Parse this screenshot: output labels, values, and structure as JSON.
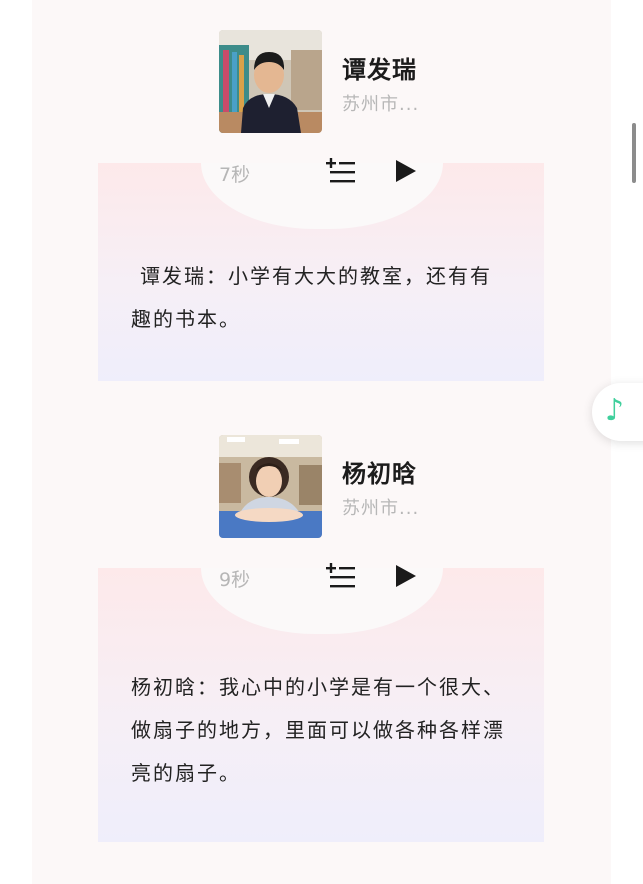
{
  "entries": [
    {
      "name": "谭发瑞",
      "location": "苏州市...",
      "duration": "7秒",
      "text": "谭发瑞：小学有大大的教室，还有有趣的书本。"
    },
    {
      "name": "杨初晗",
      "location": "苏州市...",
      "duration": "9秒",
      "text": "杨初晗：我心中的小学是有一个很大、做扇子的地方，里面可以做各种各样漂亮的扇子。"
    }
  ],
  "icons": {
    "playlist_add": "playlist-add-icon",
    "play": "play-icon",
    "music": "music-note-icon"
  },
  "colors": {
    "card_top": "#fde9ea",
    "card_bottom": "#efeefb",
    "music_accent": "#3fcf9c",
    "page_bg": "#fcf8f8"
  }
}
